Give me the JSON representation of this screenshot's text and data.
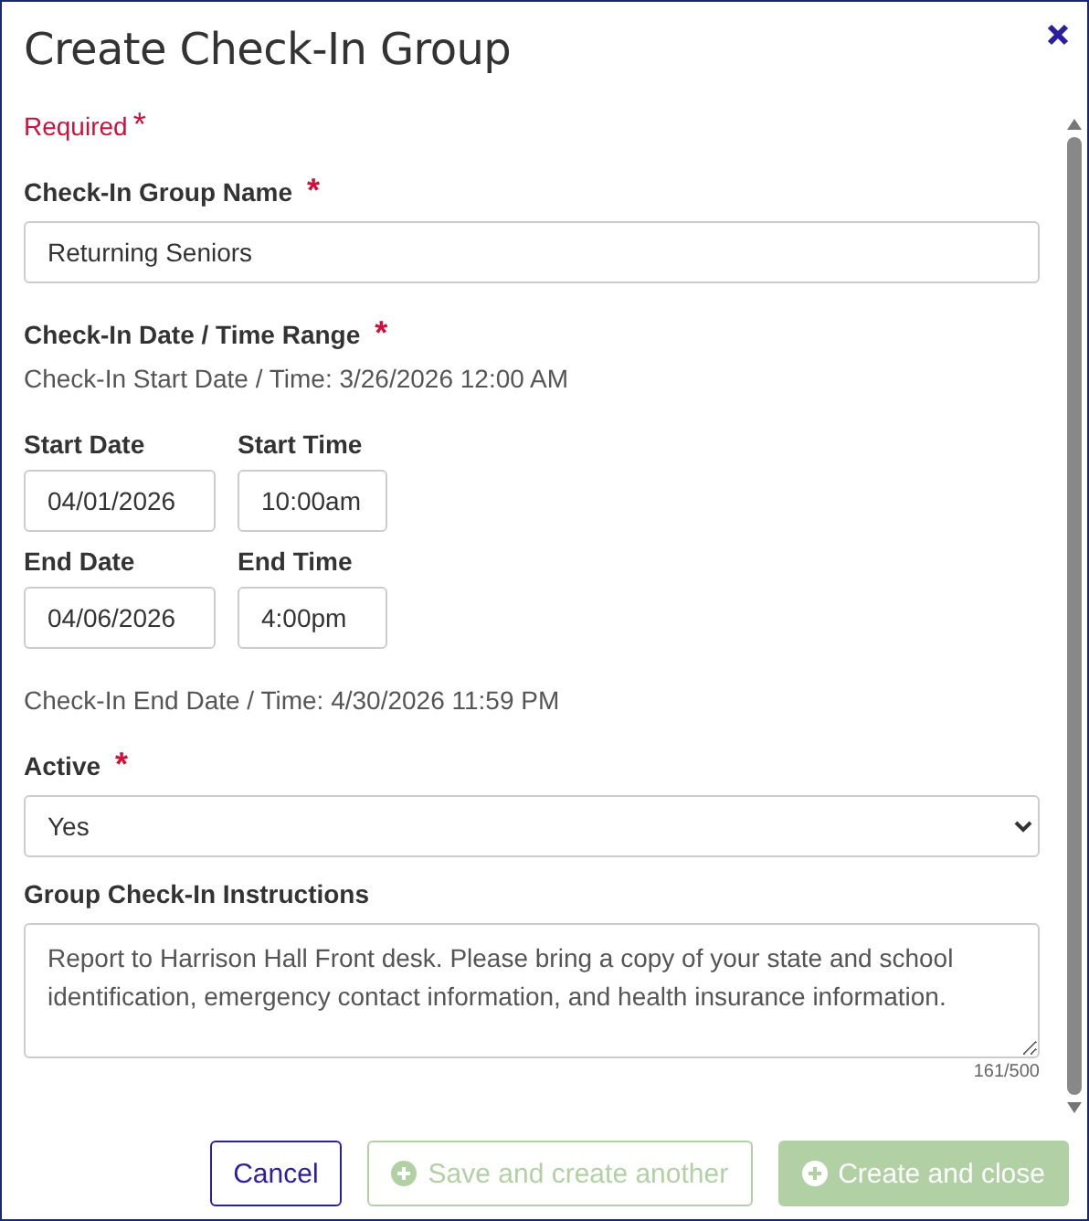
{
  "dialog": {
    "title": "Create Check-In Group"
  },
  "required_note": {
    "text": "Required",
    "mark": "*"
  },
  "name_field": {
    "label": "Check-In Group Name",
    "required": true,
    "value": "Returning Seniors"
  },
  "date_range": {
    "label": "Check-In Date / Time Range",
    "required": true,
    "start_note": "Check-In Start Date / Time: 3/26/2026 12:00 AM",
    "rows": [
      {
        "date_label": "Start Date",
        "date": "04/01/2026",
        "time_label": "Start Time",
        "time": "10:00am"
      },
      {
        "date_label": "End Date",
        "date": "04/06/2026",
        "time_label": "End Time",
        "time": "4:00pm"
      }
    ],
    "end_note": "Check-In End Date / Time: 4/30/2026 11:59 PM"
  },
  "active_field": {
    "label": "Active",
    "required": true,
    "value": "Yes"
  },
  "instructions_field": {
    "label": "Group Check-In Instructions",
    "value": "Report to Harrison Hall Front desk. Please bring a copy of your state and school identification, emergency contact information, and health insurance information.",
    "counter": "161/500"
  },
  "buttons": [
    {
      "label": "Cancel",
      "kind": "outline",
      "disabled": false
    },
    {
      "label": "Save and create another",
      "kind": "secondary",
      "disabled": true
    },
    {
      "label": "Create and close",
      "kind": "primary",
      "disabled": true
    }
  ]
}
